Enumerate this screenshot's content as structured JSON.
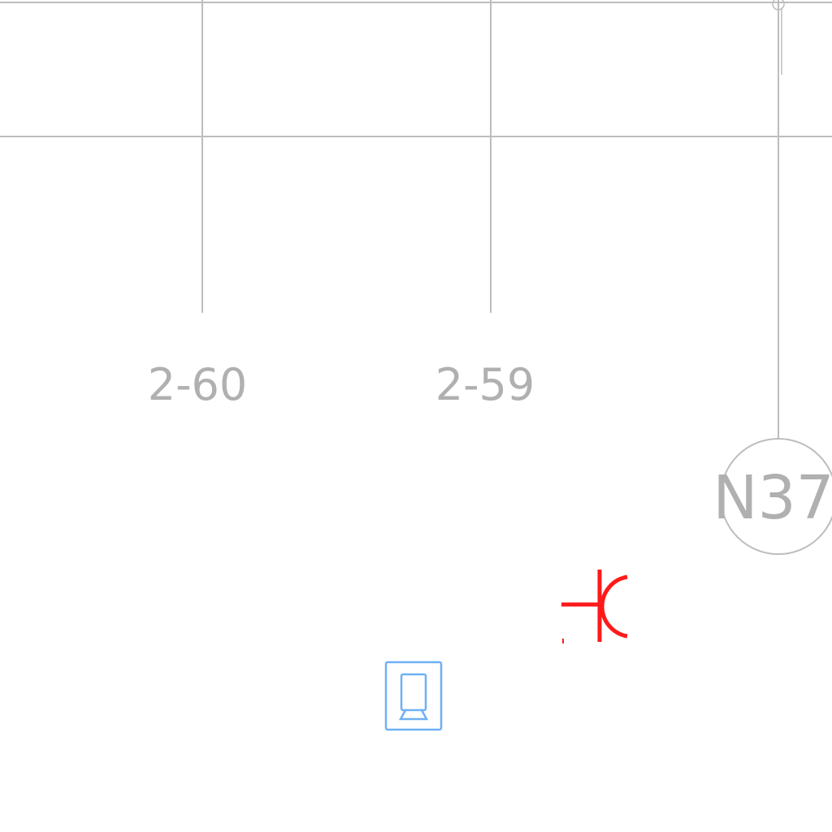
{
  "drawing": {
    "colors": {
      "grid": "#bdbdbd",
      "text": "#b0b0b0",
      "electrical": "#ff1a1a",
      "device": "#6fb0f5",
      "background": "#ffffff"
    },
    "room_labels": [
      {
        "id": "room-2-60",
        "text": "2-60"
      },
      {
        "id": "room-2-59",
        "text": "2-59"
      }
    ],
    "grid_bubble": {
      "text": "N37"
    },
    "symbols": [
      {
        "name": "receptacle-symbol",
        "type": "electrical"
      },
      {
        "name": "display-device-symbol",
        "type": "device"
      }
    ]
  }
}
